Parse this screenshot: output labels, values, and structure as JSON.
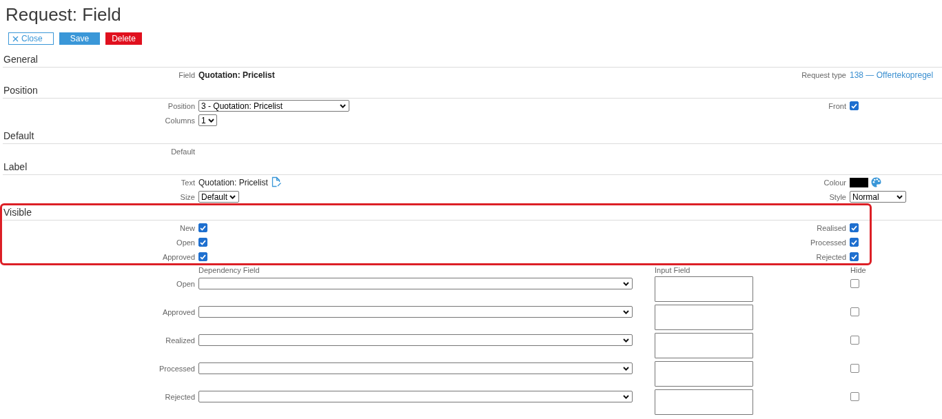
{
  "page": {
    "title": "Request: Field"
  },
  "buttons": [
    {
      "kind": "close",
      "label": "Close"
    },
    {
      "kind": "save",
      "label": "Save"
    },
    {
      "kind": "delete",
      "label": "Delete"
    }
  ],
  "sections": [
    {
      "title": "General",
      "highlighted": false,
      "rows": [
        {
          "left": {
            "label": "Field",
            "kind": "bold-text",
            "value": "Quotation: Pricelist"
          },
          "right": {
            "label": "Request type",
            "kind": "link",
            "value": "138 — Offertekopregel"
          }
        }
      ]
    },
    {
      "title": "Position",
      "highlighted": false,
      "rows": [
        {
          "left": {
            "label": "Position",
            "kind": "select",
            "value": "3 - Quotation: Pricelist"
          },
          "right": {
            "label": "Front",
            "kind": "checkbox",
            "checked": true
          }
        },
        {
          "left": {
            "label": "Columns",
            "kind": "select",
            "value": "1"
          }
        }
      ]
    },
    {
      "title": "Default",
      "highlighted": false,
      "rows": [
        {
          "left": {
            "label": "Default",
            "kind": "empty"
          }
        }
      ]
    },
    {
      "title": "Label",
      "highlighted": false,
      "rows": [
        {
          "left": {
            "label": "Text",
            "kind": "text-edit",
            "value": "Quotation: Pricelist"
          },
          "right": {
            "label": "Colour",
            "kind": "colour",
            "color": "#000000"
          }
        },
        {
          "left": {
            "label": "Size",
            "kind": "select",
            "value": "Default"
          },
          "right": {
            "label": "Style",
            "kind": "select",
            "value": "Normal"
          }
        }
      ]
    },
    {
      "title": "Visible",
      "highlighted": true,
      "rows": [
        {
          "left": {
            "label": "New",
            "kind": "checkbox",
            "checked": true
          },
          "right": {
            "label": "Realised",
            "kind": "checkbox",
            "checked": true
          }
        },
        {
          "left": {
            "label": "Open",
            "kind": "checkbox",
            "checked": true
          },
          "right": {
            "label": "Processed",
            "kind": "checkbox",
            "checked": true
          }
        },
        {
          "left": {
            "label": "Approved",
            "kind": "checkbox",
            "checked": true
          },
          "right": {
            "label": "Rejected",
            "kind": "checkbox",
            "checked": true
          }
        }
      ]
    }
  ],
  "dependencies": {
    "columns": [
      "Dependency Field",
      "Input Field",
      "Hide"
    ],
    "rows": [
      {
        "label": "Open",
        "checked": false
      },
      {
        "label": "Approved",
        "checked": false
      },
      {
        "label": "Realized",
        "checked": false
      },
      {
        "label": "Processed",
        "checked": false
      },
      {
        "label": "Rejected",
        "checked": false
      }
    ]
  }
}
